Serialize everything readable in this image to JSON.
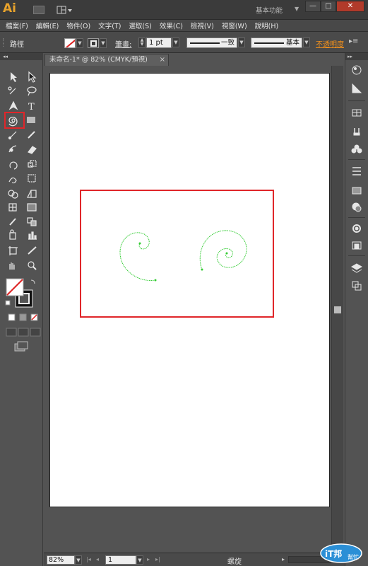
{
  "app": {
    "logo": "Ai",
    "workspace": "基本功能",
    "window_buttons": [
      "—",
      "□",
      "✕"
    ]
  },
  "menu": [
    "檔案(F)",
    "編輯(E)",
    "物件(O)",
    "文字(T)",
    "選取(S)",
    "效果(C)",
    "檢視(V)",
    "視窗(W)",
    "說明(H)"
  ],
  "control_bar": {
    "selection_label": "路徑",
    "stroke_label": "筆畫:",
    "stroke_weight": "1 pt",
    "profile1": "一致",
    "profile2": "基本",
    "opacity_label": "不透明度"
  },
  "document": {
    "tab_title": "未命名-1* @ 82% (CMYK/預視)",
    "tab_close": "×"
  },
  "status": {
    "zoom": "82%",
    "page": "1",
    "current_tool": "螺旋"
  },
  "watermark": {
    "text1": "iT邦",
    "text2": "幫忙"
  },
  "colors": {
    "accent": "#e8a32c",
    "highlight": "#e0262a",
    "spiral": "#33cc33",
    "opacity_label": "#f1901c"
  },
  "tools": [
    "selection-icon",
    "direct-selection-icon",
    "magic-wand-icon",
    "lasso-icon",
    "pen-icon",
    "type-icon",
    "spiral-icon",
    "rectangle-icon",
    "paintbrush-icon",
    "pencil-icon",
    "blob-brush-icon",
    "eraser-icon",
    "rotate-icon",
    "scale-icon",
    "warp-icon",
    "free-transform-icon",
    "shape-builder-icon",
    "perspective-grid-icon",
    "mesh-icon",
    "gradient-icon",
    "eyedropper-icon",
    "blend-icon",
    "symbol-sprayer-icon",
    "column-graph-icon",
    "artboard-icon",
    "slice-icon",
    "hand-icon",
    "zoom-icon"
  ]
}
